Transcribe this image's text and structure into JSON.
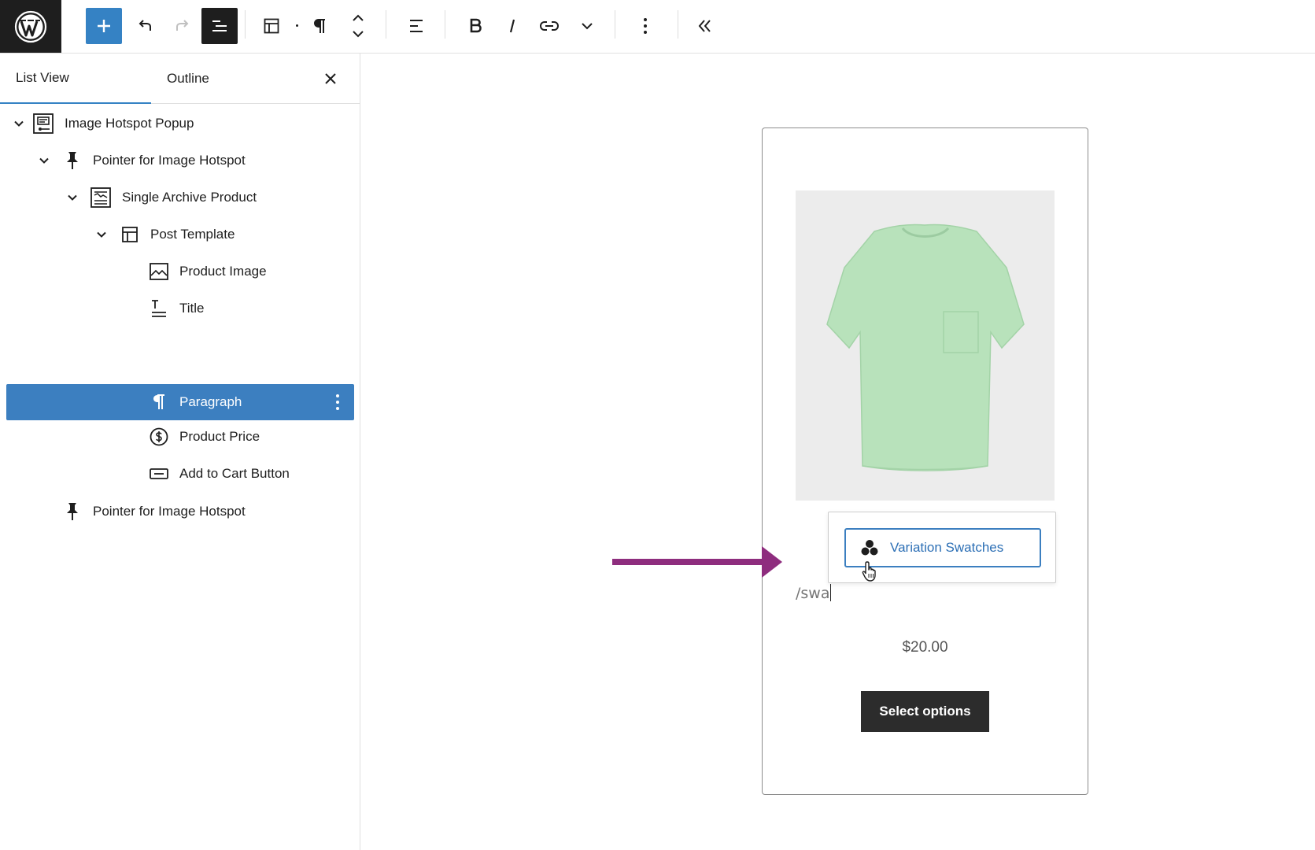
{
  "toolbar": {
    "logo": "wordpress-icon",
    "buttons": [
      "add-block",
      "undo",
      "redo",
      "document-overview",
      "block-type",
      "paragraph",
      "move-up-down",
      "align",
      "bold",
      "italic",
      "link",
      "more-rich-text",
      "options",
      "collapse"
    ]
  },
  "sidebar": {
    "tabs": {
      "list_view": "List View",
      "outline": "Outline"
    },
    "items": [
      {
        "label": "Image Hotspot Popup",
        "icon": "hotspot-icon",
        "expanded": true
      },
      {
        "label": "Pointer for Image Hotspot",
        "icon": "pin-icon",
        "expanded": true
      },
      {
        "label": "Single Archive Product",
        "icon": "archive-icon",
        "expanded": true
      },
      {
        "label": "Post Template",
        "icon": "layout-icon",
        "expanded": true
      },
      {
        "label": "Product Image",
        "icon": "image-icon"
      },
      {
        "label": "Title",
        "icon": "title-icon"
      },
      {
        "label": "Paragraph",
        "icon": "paragraph-icon",
        "selected": true
      },
      {
        "label": "Product Price",
        "icon": "dollar-icon"
      },
      {
        "label": "Add to Cart Button",
        "icon": "button-icon"
      },
      {
        "label": "Pointer for Image Hotspot",
        "icon": "pin-icon"
      }
    ]
  },
  "editor": {
    "product_image_alt": "green t-shirt",
    "autocomplete": {
      "label": "Variation Swatches",
      "icon": "swatches-icon"
    },
    "typed_text": "/swa",
    "price": "$20.00",
    "select_button": "Select options"
  },
  "colors": {
    "accent": "#3582c4",
    "selected_row": "#3c7fc0",
    "arrow": "#8e2d7e",
    "shirt": "#b8e2bb"
  }
}
